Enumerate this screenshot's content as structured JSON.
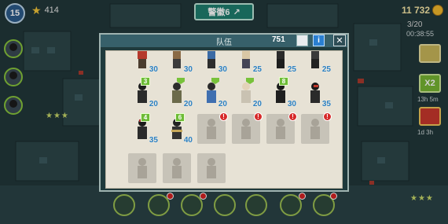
{
  "hud": {
    "level": "15",
    "stars": "414",
    "upgrade_label": "警徽6",
    "upgrade_icon": "arrow-upright-icon",
    "coins": "11 732",
    "population": "3/20",
    "timer_top": "00:38:55",
    "x2_label": "X2",
    "x2_timer": "13h 5m",
    "gift_timer": "1d 3h"
  },
  "dialog": {
    "title": "队伍",
    "count": "751"
  },
  "roster": {
    "row0": [
      {
        "level": "30"
      },
      {
        "level": "30"
      },
      {
        "level": "30"
      },
      {
        "level": "25"
      },
      {
        "level": "25"
      },
      {
        "level": "25"
      }
    ],
    "row1": [
      {
        "rank": "3",
        "level": "20"
      },
      {
        "level": "20"
      },
      {
        "level": "20"
      },
      {
        "level": "20"
      },
      {
        "rank": "8",
        "level": "30"
      },
      {
        "level": "35"
      }
    ],
    "row2": [
      {
        "rank": "4",
        "level": "35"
      },
      {
        "rank": "6",
        "level": "40"
      }
    ]
  },
  "colors": {
    "accent_green": "#6dbb36",
    "level_blue": "#2a7fc0",
    "alert_red": "#d62a2a",
    "gold": "#f2b92c"
  }
}
